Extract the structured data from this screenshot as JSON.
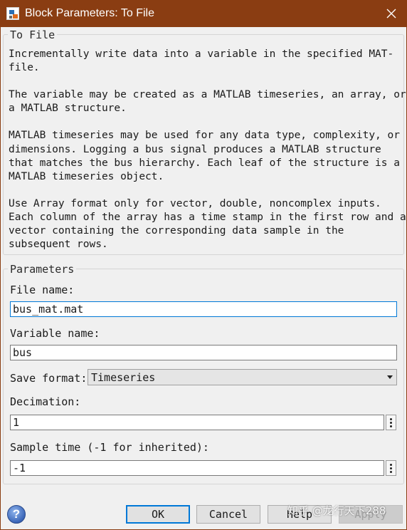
{
  "window": {
    "title": "Block Parameters: To File",
    "icons": {
      "app": "simulink-icon",
      "close": "close-icon"
    }
  },
  "block_group": {
    "legend": "To File",
    "description_lines": [
      "Incrementally write data into a variable in the specified MAT-",
      "file.",
      "",
      "The variable may be created as a MATLAB timeseries, an array, or",
      "a MATLAB structure.",
      "",
      "MATLAB timeseries may be used for any data type, complexity, or",
      "dimensions. Logging a bus signal produces a MATLAB structure",
      "that matches the bus hierarchy. Each leaf of the structure is a",
      "MATLAB timeseries object.",
      "",
      "Use Array format only for vector, double, noncomplex inputs.",
      "Each column of the array has a time stamp in the first row and a",
      "vector containing the corresponding data sample in the",
      "subsequent rows."
    ]
  },
  "parameters": {
    "legend": "Parameters",
    "file_name": {
      "label": "File name:",
      "value": "bus_mat.mat"
    },
    "variable_name": {
      "label": "Variable name:",
      "value": "bus"
    },
    "save_format": {
      "label": "Save format:",
      "value": "Timeseries"
    },
    "decimation": {
      "label": "Decimation:",
      "value": "1"
    },
    "sample_time": {
      "label": "Sample time (-1 for inherited):",
      "value": "-1"
    }
  },
  "footer": {
    "help_icon_glyph": "?",
    "ok_label": "OK",
    "cancel_label": "Cancel",
    "help_label": "Help",
    "apply_label": "Apply",
    "watermark_text": "知乎 @龙行天下288"
  },
  "colors": {
    "titlebar": "#8a3d12",
    "focus_border": "#0078d7",
    "dialog_bg": "#f0f0f0"
  }
}
